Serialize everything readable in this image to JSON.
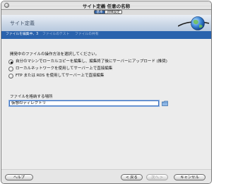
{
  "window": {
    "title": "サイト定義 任意の名称"
  },
  "mode_tabs": {
    "basic": "基本",
    "advanced": "詳細設定"
  },
  "header": {
    "title": "サイト定義"
  },
  "steps": [
    {
      "label": "ファイルを編集中、3"
    },
    {
      "label": "ファイルのテスト"
    },
    {
      "label": "ファイルの共有"
    }
  ],
  "form": {
    "prompt": "開発中のファイルの操作方法を選択してください。",
    "options": [
      {
        "label": "自分のマシンでローカルコピーを編集し、編集終了後にサーバーにアップロード (推奨)",
        "selected": true
      },
      {
        "label": "ローカルネットワークを使用してサーバー上で直接編集",
        "selected": false
      },
      {
        "label": "FTP または RDS を使用してサーバー上で直接編集",
        "selected": false
      }
    ],
    "folder_label": "ファイルを格納する場所",
    "folder_value": "仮想のディレクトリ"
  },
  "buttons": {
    "help": "ヘルプ",
    "back": "< 戻る",
    "next": "次へ >",
    "cancel": "キャンセル"
  },
  "colors": {
    "steps_bar": "#2a63ad",
    "accent": "#3f73be"
  }
}
